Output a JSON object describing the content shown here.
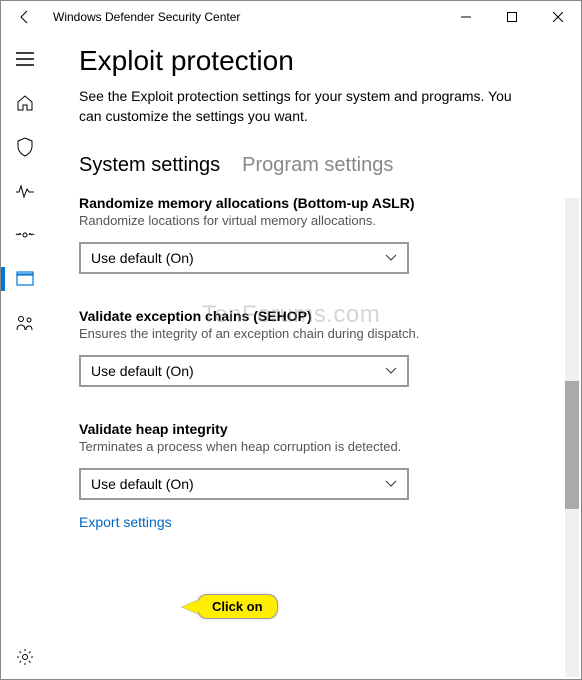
{
  "window": {
    "title": "Windows Defender Security Center"
  },
  "page": {
    "title": "Exploit protection",
    "subtitle": "See the Exploit protection settings for your system and programs.  You can customize the settings you want."
  },
  "tabs": {
    "system": "System settings",
    "program": "Program settings"
  },
  "settings": [
    {
      "title": "Randomize memory allocations (Bottom-up ASLR)",
      "desc": "Randomize locations for virtual memory allocations.",
      "value": "Use default (On)"
    },
    {
      "title": "Validate exception chains (SEHOP)",
      "desc": "Ensures the integrity of an exception chain during dispatch.",
      "value": "Use default (On)"
    },
    {
      "title": "Validate heap integrity",
      "desc": "Terminates a process when heap corruption is detected.",
      "value": "Use default (On)"
    }
  ],
  "export_link": "Export settings",
  "callout": "Click on",
  "watermark": "TenForums.com"
}
